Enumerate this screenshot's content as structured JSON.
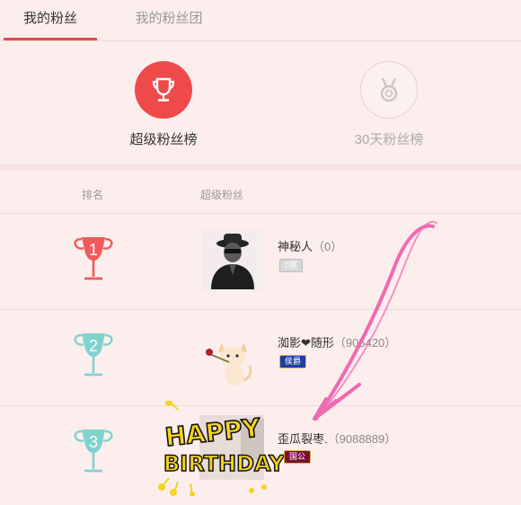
{
  "tabs": {
    "my_fans": "我的粉丝",
    "my_fan_club": "我的粉丝团"
  },
  "rank_switch": {
    "super_label": "超级粉丝榜",
    "days_label": "30天粉丝榜"
  },
  "columns": {
    "rank": "排名",
    "super_fans": "超级粉丝"
  },
  "fans": [
    {
      "rank": "1",
      "name": "神秘人",
      "score": "（0）",
      "badge": "0富",
      "trophy_color": "#ef5a5a",
      "icon": "mystery-man-avatar"
    },
    {
      "rank": "2",
      "name": "洳影❤随形",
      "score": "（905420）",
      "badge": "侯爵",
      "trophy_color": "#7fd3cd",
      "icon": "cat-with-rose-avatar"
    },
    {
      "rank": "3",
      "name": "歪瓜裂枣.",
      "score": "（9088889）",
      "badge": "国公",
      "trophy_color": "#7fd3cd",
      "icon": "happy-birthday-avatar"
    }
  ],
  "birthday_sticker": {
    "line1": "HAPPY",
    "line2": "BIRTHDAY"
  },
  "colors": {
    "accent": "#e8484b",
    "background": "#fdeeee",
    "annotation_arrow": "#f06ab0"
  }
}
